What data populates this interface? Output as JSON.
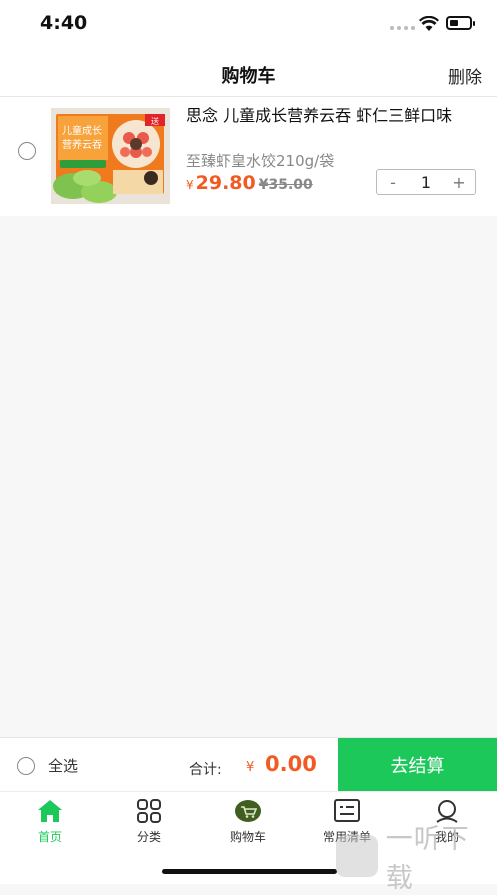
{
  "status_bar": {
    "time": "4:40"
  },
  "nav": {
    "title": "购物车",
    "delete_label": "删除"
  },
  "cart": {
    "items": [
      {
        "title": "思念 儿童成长营养云吞 虾仁三鲜口味",
        "subtitle": "至臻虾皇水饺210g/袋",
        "currency": "¥",
        "price": "29.80",
        "original_price": "¥35.00",
        "quantity": "1",
        "minus": "-",
        "plus": "+",
        "thumb_text": {
          "badge": "送",
          "line1": "儿童成长",
          "line2": "营养云吞"
        }
      }
    ]
  },
  "checkout": {
    "select_all_label": "全选",
    "total_label": "合计:",
    "total_currency": "¥",
    "total_value": "0.00",
    "button_label": "去结算"
  },
  "tabs": [
    {
      "label": "首页",
      "icon": "home-icon",
      "active": true
    },
    {
      "label": "分类",
      "icon": "category-grid-icon",
      "active": false
    },
    {
      "label": "购物车",
      "icon": "cart-icon",
      "active": false
    },
    {
      "label": "常用清单",
      "icon": "list-icon",
      "active": false
    },
    {
      "label": "我的",
      "icon": "profile-icon",
      "active": false
    }
  ],
  "watermark": {
    "text": "一听下载"
  },
  "colors": {
    "accent": "#1dc85a",
    "price": "#f15a22"
  }
}
